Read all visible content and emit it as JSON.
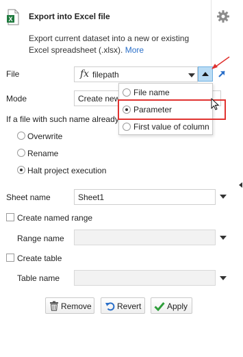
{
  "header": {
    "title": "Export into Excel file",
    "description": "Export current dataset into a new or existing Excel spreadsheet (.xlsx).",
    "more_link": "More"
  },
  "file": {
    "label": "File",
    "value": "filepath",
    "fx_symbol": "fx",
    "source_options": [
      {
        "label": "File name",
        "selected": false
      },
      {
        "label": "Parameter",
        "selected": true
      },
      {
        "label": "First value of column",
        "selected": false
      }
    ]
  },
  "mode": {
    "label": "Mode",
    "value_visible": "Create new"
  },
  "exists": {
    "question": "If a file with such name already",
    "options": [
      {
        "label": "Overwrite",
        "selected": false
      },
      {
        "label": "Rename",
        "selected": false
      },
      {
        "label": "Halt project execution",
        "selected": true
      }
    ]
  },
  "sheet": {
    "label": "Sheet name",
    "value": "Sheet1"
  },
  "named_range": {
    "checkbox_label": "Create named range",
    "checked": false,
    "field_label": "Range name",
    "value": ""
  },
  "table": {
    "checkbox_label": "Create table",
    "checked": false,
    "field_label": "Table name",
    "value": ""
  },
  "buttons": {
    "remove": "Remove",
    "revert": "Revert",
    "apply": "Apply"
  },
  "colors": {
    "accent_link": "#2a6fc9",
    "highlight_box": "#e0322f",
    "annotation_arrow": "#e0322f",
    "excel_green": "#1f7a3e",
    "apply_check": "#2e9e3a",
    "revert_arrow": "#2a6fc9",
    "active_button": "#b9dcf5"
  }
}
